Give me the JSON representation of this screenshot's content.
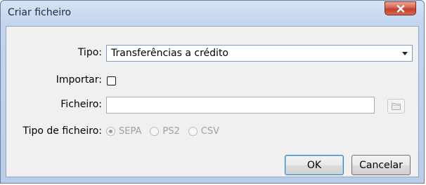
{
  "window": {
    "title": "Criar ficheiro"
  },
  "form": {
    "tipo_label": "Tipo:",
    "tipo_value": "Transferências a crédito",
    "importar_label": "Importar:",
    "importar_checked": false,
    "ficheiro_label": "Ficheiro:",
    "ficheiro_value": "",
    "tipo_ficheiro_label": "Tipo de ficheiro:",
    "tipo_ficheiro_options": [
      "SEPA",
      "PS2",
      "CSV"
    ],
    "tipo_ficheiro_selected": "SEPA",
    "tipo_ficheiro_enabled": false
  },
  "buttons": {
    "ok_label": "OK",
    "cancel_label": "Cancelar"
  },
  "icons": {
    "close": "close-icon",
    "dropdown": "chevron-down-icon",
    "browse": "folder-icon"
  },
  "colors": {
    "close_button": "#c9452f",
    "title_bar": "#c4d6ee",
    "client_bg": "#f0f0f0",
    "default_button_border": "#3c7fb1"
  }
}
